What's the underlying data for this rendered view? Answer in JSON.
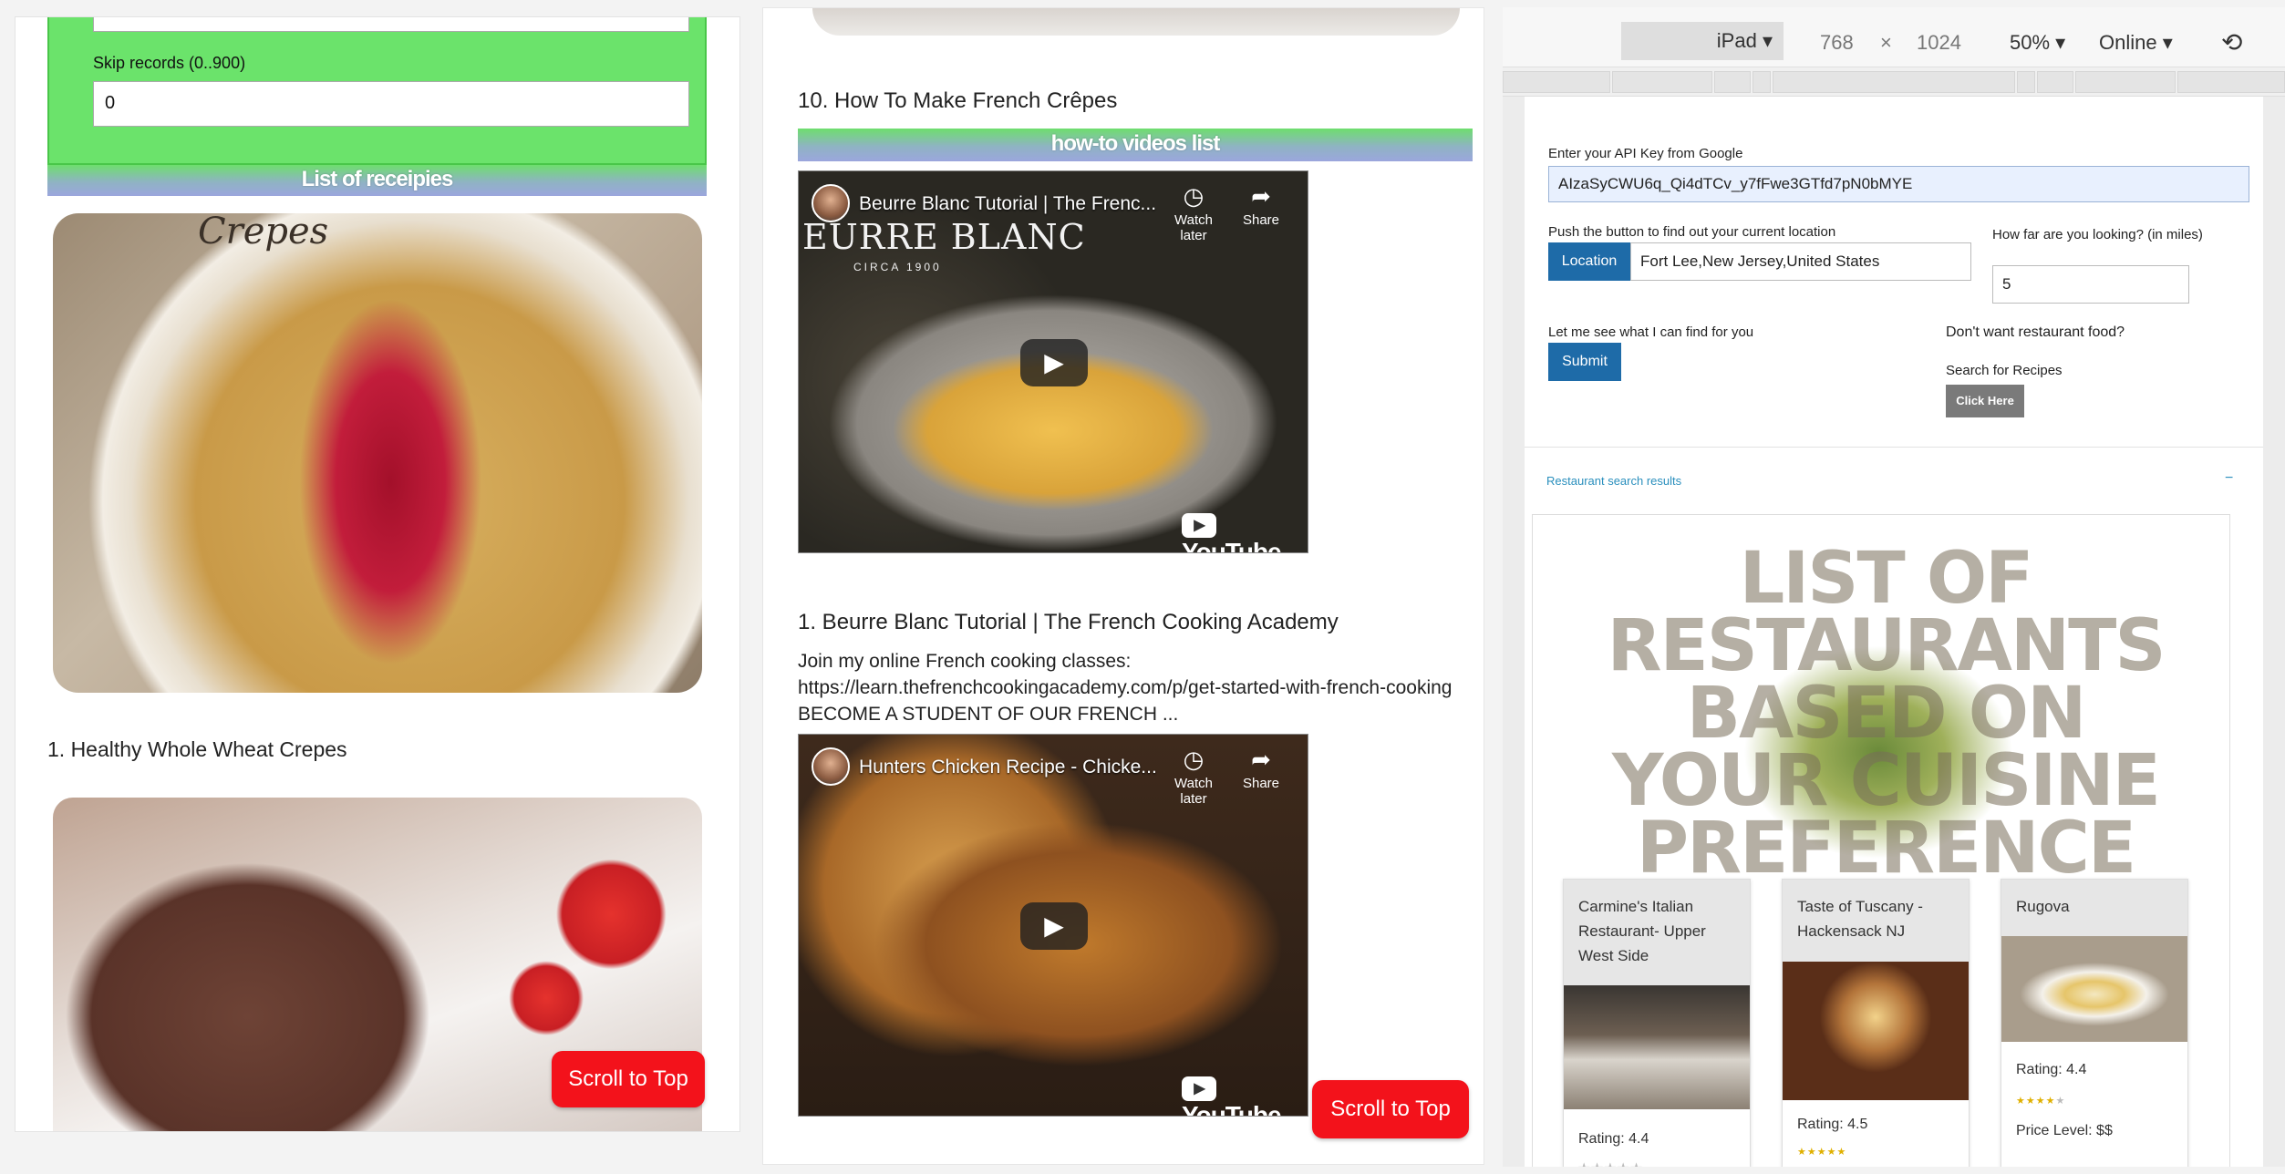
{
  "panel1": {
    "skip_label": "Skip records (0..900)",
    "skip_value": "0",
    "list_header": "List of receipies",
    "image_script_label": "Crepes",
    "recipe1_title": "1. Healthy Whole Wheat Crepes",
    "scroll_top": "Scroll to Top"
  },
  "panel2": {
    "heading": "10. How To Make French Crêpes",
    "list_header": "how-to videos list",
    "video1": {
      "title": "Beurre Blanc Tutorial | The Frenc...",
      "overlay_text": "EURRE BLANC",
      "overlay_sub": "CIRCA 1900",
      "watch_later": "Watch later",
      "share": "Share",
      "logo": "YouTube"
    },
    "video1_heading": "1. Beurre Blanc Tutorial | The French Cooking Academy",
    "video1_desc": "Join my online French cooking classes: https://learn.thefrenchcookingacademy.com/p/get-started-with-french-cooking BECOME A STUDENT OF OUR FRENCH ...",
    "video2": {
      "title": "Hunters Chicken Recipe - Chicke...",
      "watch_later": "Watch later",
      "share": "Share",
      "logo": "YouTube"
    },
    "scroll_top": "Scroll to Top"
  },
  "panel3": {
    "toolbar": {
      "device": "iPad",
      "width": "768",
      "times": "×",
      "height": "1024",
      "zoom": "50%",
      "network": "Online"
    },
    "api_label": "Enter your API Key from Google",
    "api_value": "AIzaSyCWU6q_Qi4dTCv_y7fFwe3GTfd7pN0bMYE",
    "location_label": "Push the button to find out your current location",
    "location_button": "Location",
    "location_value": "Fort Lee,New Jersey,United States",
    "distance_label": "How far are you looking? (in miles)",
    "distance_value": "5",
    "submit_label": "Let me see what I can find for you",
    "submit_button": "Submit",
    "norest_label": "Don't want restaurant food?",
    "search_recipes_label": "Search for Recipes",
    "click_here": "Click Here",
    "results_label": "Restaurant search results",
    "results_toggle": "−",
    "banner_text": "LIST OF RESTAURANTS BASED ON YOUR CUISINE PREFERENCE",
    "cards": [
      {
        "name": "Carmine's Italian Restaurant- Upper West Side",
        "rating": "Rating: 4.4",
        "stars": 4.4
      },
      {
        "name": "Taste of Tuscany - Hackensack NJ",
        "rating": "Rating: 4.5",
        "stars": 4.5
      },
      {
        "name": "Rugova",
        "rating": "Rating: 4.4",
        "stars": 4.4,
        "price": "Price Level: $$"
      }
    ]
  },
  "icons": [
    "dropdown-caret-icon",
    "rotate-icon",
    "clock-icon",
    "share-icon",
    "play-icon",
    "youtube-logo-icon",
    "star-icon",
    "resize-handle-icon"
  ],
  "colors": {
    "green_panel": "#6be36b",
    "scroll_red": "#f3121b",
    "button_blue": "#1e6ba8",
    "link_blue": "#2a8fbd"
  }
}
